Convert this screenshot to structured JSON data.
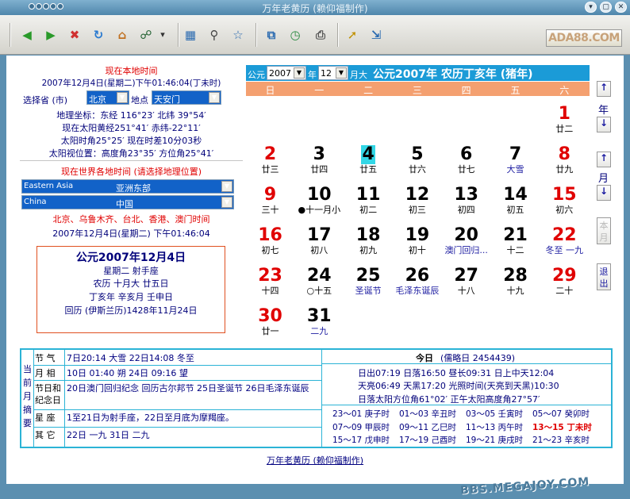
{
  "window": {
    "title": "万年老黄历 (赖仰福制作)",
    "min": "▾",
    "max": "▢",
    "close": "✕"
  },
  "toolbar": {
    "buttons": [
      {
        "name": "back-icon",
        "glyph": "◀",
        "color": "#2a9a2a"
      },
      {
        "name": "forward-icon",
        "glyph": "▶",
        "color": "#2a9a2a"
      },
      {
        "name": "stop-icon",
        "glyph": "✖",
        "color": "#d03030"
      },
      {
        "name": "refresh-icon",
        "glyph": "↻",
        "color": "#2a7ad0"
      },
      {
        "name": "home-icon",
        "glyph": "⌂",
        "color": "#c07020"
      },
      {
        "name": "network-icon",
        "glyph": "☍",
        "color": "#206030"
      },
      {
        "name": "dropdown-arrow-icon",
        "glyph": "▾",
        "color": "#333"
      },
      {
        "name": "view-icon",
        "glyph": "▦",
        "color": "#2a6ab0"
      },
      {
        "name": "search-icon",
        "glyph": "⚲",
        "color": "#444"
      },
      {
        "name": "favorites-icon",
        "glyph": "☆",
        "color": "#2a6ab0"
      },
      {
        "name": "window-icon",
        "glyph": "⧉",
        "color": "#2a6ab0"
      },
      {
        "name": "history-icon",
        "glyph": "◷",
        "color": "#2a8a40"
      },
      {
        "name": "print-icon",
        "glyph": "⎙",
        "color": "#555"
      },
      {
        "name": "pointer-icon",
        "glyph": "➚",
        "color": "#c09000"
      },
      {
        "name": "exit-door-icon",
        "glyph": "⇲",
        "color": "#2a6ab0"
      }
    ],
    "logo": "ADA88.COM"
  },
  "left": {
    "local_title": "现在本地时间",
    "local_datetime": "2007年12月4日(星期二)下午01:46:04(丁未时)",
    "province_label": "选择省 (市)",
    "province_value": "北京",
    "place_label": "地点",
    "place_value": "天安门",
    "coords": "地理坐标：东经 116°23′  北纬 39°54′",
    "sun_ecl": "现在太阳黄经251°41′  赤纬-22°11′",
    "sun_hour": "太阳时角25°25′  现在时差10分03秒",
    "sun_pos": "太阳视位置：高度角23°35′  方位角25°41′",
    "world_title": "现在世界各地时间 (请选择地理位置)",
    "region_en": "Eastern Asia",
    "region_cn": "亚洲东部",
    "country_en": "China",
    "country_cn": "中国",
    "cities": "北京、乌鲁木齐、台北、香港、澳门时间",
    "world_datetime": "2007年12月4日(星期二) 下午01:46:04",
    "box_date": "公元2007年12月4日",
    "box_week": "星期二  射手座",
    "box_lunar": "农历 十月大 廿五日",
    "box_ganzhi": "丁亥年  辛亥月  壬申日",
    "box_islamic": "回历 (伊斯兰历)1428年11月24日"
  },
  "calendar": {
    "prefix": "公元",
    "year": "2007",
    "year_unit": "年",
    "month": "12",
    "month_unit": "月大",
    "heading": "公元2007年  农历丁亥年 (猪年)",
    "weekdays": [
      "日",
      "一",
      "二",
      "三",
      "四",
      "五",
      "六"
    ],
    "days": [
      {
        "n": "1",
        "l": "廿二",
        "col": 6,
        "row": 0,
        "cls": "sat"
      },
      {
        "n": "2",
        "l": "廿三",
        "col": 0,
        "row": 1,
        "cls": "sun"
      },
      {
        "n": "3",
        "l": "廿四",
        "col": 1,
        "row": 1,
        "cls": "normal"
      },
      {
        "n": "4",
        "l": "廿五",
        "col": 2,
        "row": 1,
        "cls": "normal today"
      },
      {
        "n": "5",
        "l": "廿六",
        "col": 3,
        "row": 1,
        "cls": "normal"
      },
      {
        "n": "6",
        "l": "廿七",
        "col": 4,
        "row": 1,
        "cls": "normal"
      },
      {
        "n": "7",
        "l": "大雪",
        "col": 5,
        "row": 1,
        "cls": "normal",
        "lc": "#1a1aa0"
      },
      {
        "n": "8",
        "l": "廿九",
        "col": 6,
        "row": 1,
        "cls": "sat"
      },
      {
        "n": "9",
        "l": "三十",
        "col": 0,
        "row": 2,
        "cls": "sun"
      },
      {
        "n": "10",
        "l": "●十一月小",
        "col": 1,
        "row": 2,
        "cls": "normal"
      },
      {
        "n": "11",
        "l": "初二",
        "col": 2,
        "row": 2,
        "cls": "normal"
      },
      {
        "n": "12",
        "l": "初三",
        "col": 3,
        "row": 2,
        "cls": "normal"
      },
      {
        "n": "13",
        "l": "初四",
        "col": 4,
        "row": 2,
        "cls": "normal"
      },
      {
        "n": "14",
        "l": "初五",
        "col": 5,
        "row": 2,
        "cls": "normal"
      },
      {
        "n": "15",
        "l": "初六",
        "col": 6,
        "row": 2,
        "cls": "sat"
      },
      {
        "n": "16",
        "l": "初七",
        "col": 0,
        "row": 3,
        "cls": "sun"
      },
      {
        "n": "17",
        "l": "初八",
        "col": 1,
        "row": 3,
        "cls": "normal"
      },
      {
        "n": "18",
        "l": "初九",
        "col": 2,
        "row": 3,
        "cls": "normal"
      },
      {
        "n": "19",
        "l": "初十",
        "col": 3,
        "row": 3,
        "cls": "normal"
      },
      {
        "n": "20",
        "l": "澳门回归...",
        "col": 4,
        "row": 3,
        "cls": "normal",
        "lc": "#1a1aa0"
      },
      {
        "n": "21",
        "l": "十二",
        "col": 5,
        "row": 3,
        "cls": "normal"
      },
      {
        "n": "22",
        "l": "冬至 一九",
        "col": 6,
        "row": 3,
        "cls": "sat",
        "lc": "#1a1aa0"
      },
      {
        "n": "23",
        "l": "十四",
        "col": 0,
        "row": 4,
        "cls": "sun"
      },
      {
        "n": "24",
        "l": "○十五",
        "col": 1,
        "row": 4,
        "cls": "normal"
      },
      {
        "n": "25",
        "l": "圣诞节",
        "col": 2,
        "row": 4,
        "cls": "normal",
        "lc": "#1a1aa0"
      },
      {
        "n": "26",
        "l": "毛泽东诞辰",
        "col": 3,
        "row": 4,
        "cls": "normal",
        "lc": "#1a1aa0"
      },
      {
        "n": "27",
        "l": "十八",
        "col": 4,
        "row": 4,
        "cls": "normal"
      },
      {
        "n": "28",
        "l": "十九",
        "col": 5,
        "row": 4,
        "cls": "normal"
      },
      {
        "n": "29",
        "l": "二十",
        "col": 6,
        "row": 4,
        "cls": "sat"
      },
      {
        "n": "30",
        "l": "廿一",
        "col": 0,
        "row": 5,
        "cls": "sun"
      },
      {
        "n": "31",
        "l": "二九",
        "col": 1,
        "row": 5,
        "cls": "normal",
        "lc": "#1a1aa0"
      }
    ]
  },
  "side": {
    "year_up": "↑",
    "year_label": "年",
    "year_down": "↓",
    "month_up": "↑",
    "month_label": "月",
    "month_down": "↓",
    "this_month": "本月",
    "exit": "退出"
  },
  "summary": {
    "side_label": "当前月摘要",
    "rows": [
      {
        "label": "节  气",
        "value": "7日20:14 大雪    22日14:08 冬至"
      },
      {
        "label": "月  相",
        "value": "10日 01:40 朔     24日 09:16 望"
      },
      {
        "label": "节日和纪念日",
        "value": "20日澳门回归纪念 回历古尔邦节 25日圣诞节 26日毛泽东诞辰"
      },
      {
        "label": "星  座",
        "value": "1至21日为射手座，22日至月底为摩羯座。"
      },
      {
        "label": "其  它",
        "value": "22日 一九   31日 二九"
      }
    ],
    "today_title": "今日",
    "julian": "(儒略日 2454439)",
    "sun_line": "日出07:19 日落16:50  昼长09:31  日上中天12:04",
    "sky_line": "天亮06:49 天黑17:20  光照时间(天亮到天黑)10:30",
    "azimuth_line": "日落太阳方位角61°02′  正午太阳高度角27°57′",
    "hours": [
      "23～01 庚子时",
      "01～03 辛丑时",
      "03～05 壬寅时",
      "05～07 癸卯时",
      "07～09 甲辰时",
      "09～11 乙巳时",
      "11～13 丙午时",
      "13～15 丁未时",
      "15～17 戊申时",
      "17～19 己酉时",
      "19～21 庚戌时",
      "21～23 辛亥时"
    ],
    "current_hour_index": 7
  },
  "footer": "万年老黄历 (赖仰福制作)",
  "watermark": "BBS.MEGAJOY.COM"
}
